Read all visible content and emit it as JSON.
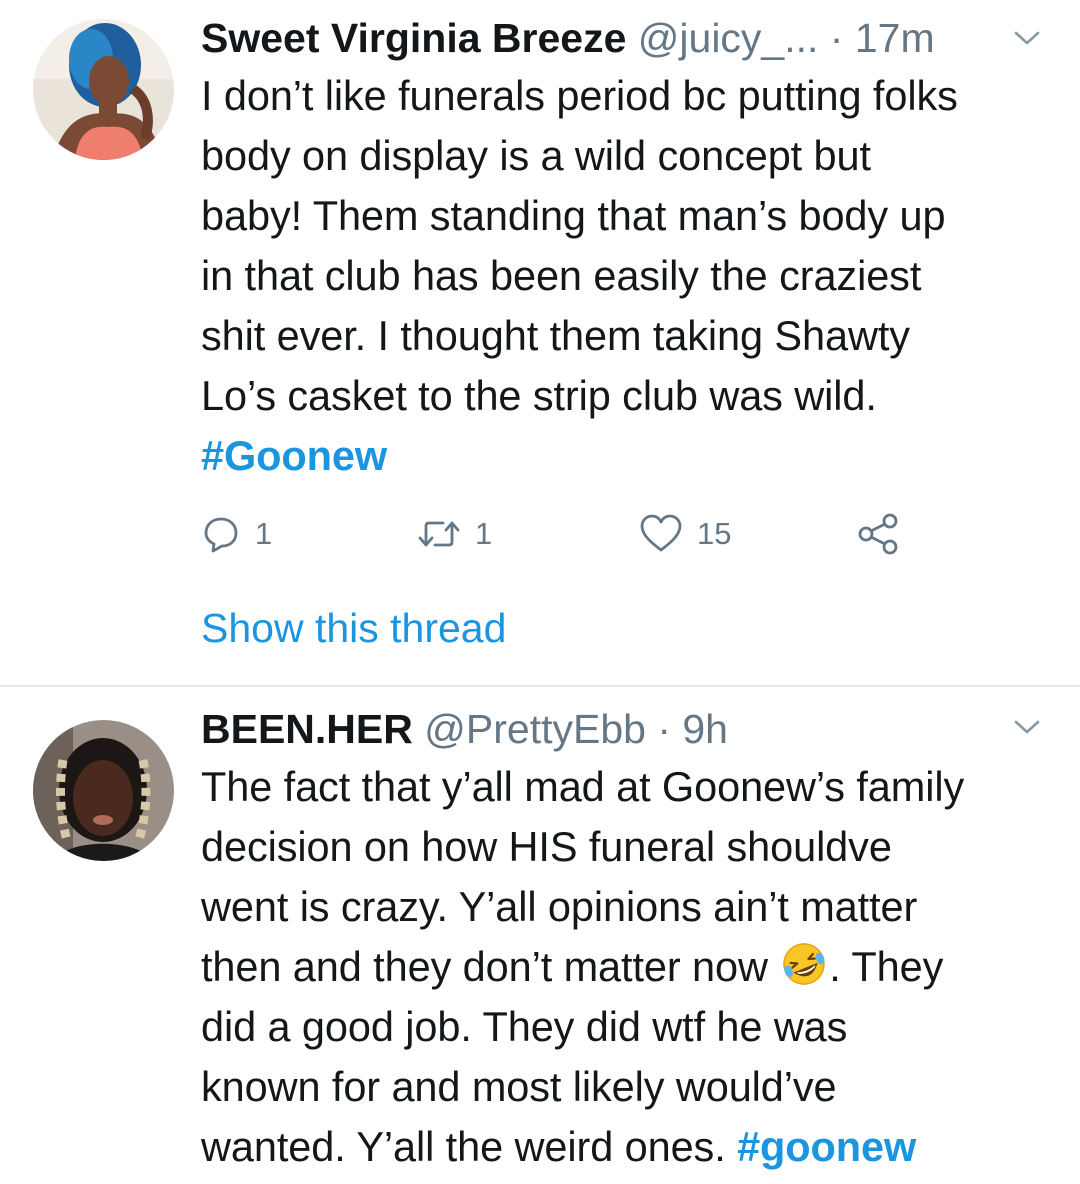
{
  "tweets": [
    {
      "display_name": "Sweet Virginia Breeze",
      "handle": "@juicy_...",
      "separator": " · ",
      "time": "17m",
      "text_lines": [
        "I don’t like funerals period bc putting folks",
        "body on display is a wild concept but",
        "baby! Them standing that man’s body up",
        "in that club has been easily the craziest",
        "shit ever. I thought them taking Shawty",
        "Lo’s casket to the strip club was wild."
      ],
      "hashtag": "#Goonew",
      "reply_count": "1",
      "retweet_count": "1",
      "like_count": "15",
      "show_thread_label": "Show this thread",
      "avatar_icon": "user-avatar-blue-hair",
      "menu_icon": "chevron-down-icon"
    },
    {
      "display_name": "BEEN.HER",
      "handle": "@PrettyEbb",
      "separator": " · ",
      "time": "9h",
      "text_lines": [
        "The fact that y’all mad at Goonew’s family",
        "decision on how HIS funeral shouldve",
        "went is crazy. Y’all opinions ain’t matter",
        "then and they don’t matter now",
        ". They",
        "did a good job. They did  wtf he was",
        "known for and most likely would’ve",
        "wanted. Y’all the weird ones."
      ],
      "hashtag": "#goonew",
      "emoji_icon": "rolling-on-floor-laughing-emoji",
      "avatar_icon": "user-avatar-braids",
      "menu_icon": "chevron-down-icon"
    }
  ],
  "colors": {
    "link_blue": "#1b95e0",
    "secondary_gray": "#657786",
    "text": "#14171a",
    "divider": "#e1e8ed"
  }
}
